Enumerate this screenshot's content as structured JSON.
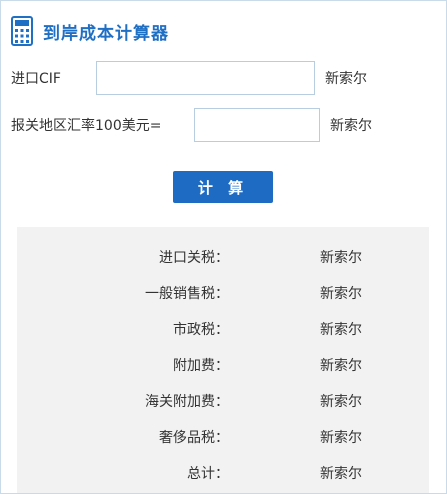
{
  "header": {
    "title": "到岸成本计算器"
  },
  "form": {
    "cif_label": "进口CIF",
    "cif_value": "",
    "cif_unit": "新索尔",
    "rate_label": "报关地区汇率100美元=",
    "rate_value": "",
    "rate_unit": "新索尔",
    "calc_button": "计 算"
  },
  "results": [
    {
      "label": "进口关税：",
      "unit": "新索尔"
    },
    {
      "label": "一般销售税：",
      "unit": "新索尔"
    },
    {
      "label": "市政税：",
      "unit": "新索尔"
    },
    {
      "label": "附加费：",
      "unit": "新索尔"
    },
    {
      "label": "海关附加费：",
      "unit": "新索尔"
    },
    {
      "label": "奢侈品税：",
      "unit": "新索尔"
    },
    {
      "label": "总计：",
      "unit": "新索尔"
    }
  ],
  "colors": {
    "accent": "#1d6bc3",
    "title": "#1f6fc5",
    "result_bg": "#f2f2f2"
  },
  "icons": [
    "calculator-icon"
  ]
}
